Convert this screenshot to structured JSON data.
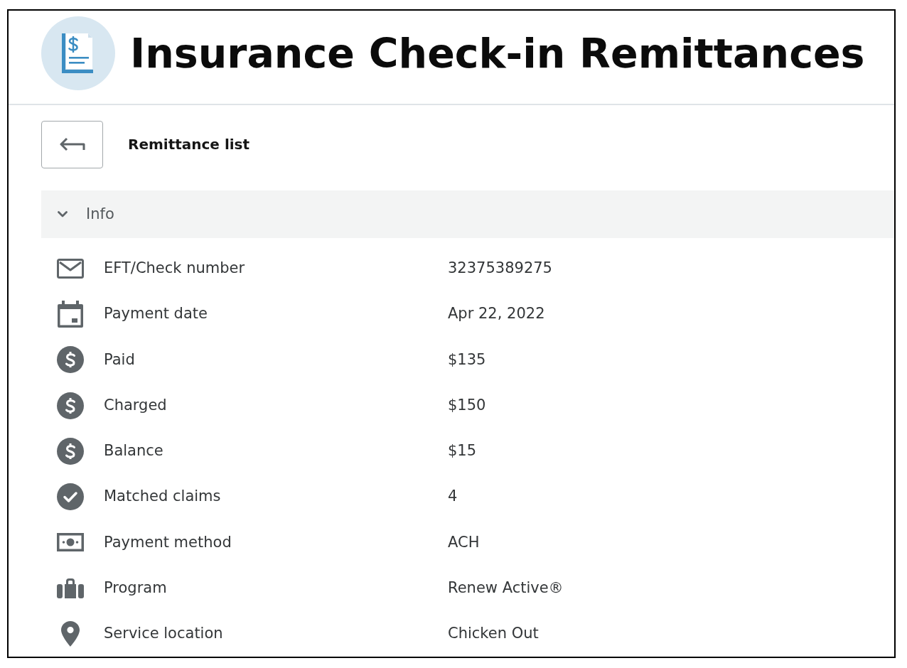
{
  "header": {
    "title": "Insurance Check-in Remittances"
  },
  "navigation": {
    "back_label": "Remittance list"
  },
  "info_section": {
    "title": "Info",
    "expanded": true,
    "fields": [
      {
        "label": "EFT/Check number",
        "value": "32375389275"
      },
      {
        "label": "Payment date",
        "value": "Apr 22, 2022"
      },
      {
        "label": "Paid",
        "value": "$135"
      },
      {
        "label": "Charged",
        "value": "$150"
      },
      {
        "label": "Balance",
        "value": "$15"
      },
      {
        "label": "Matched claims",
        "value": "4"
      },
      {
        "label": "Payment method",
        "value": "ACH"
      },
      {
        "label": "Program",
        "value": "Renew Active®"
      },
      {
        "label": "Service location",
        "value": "Chicken Out"
      }
    ]
  }
}
